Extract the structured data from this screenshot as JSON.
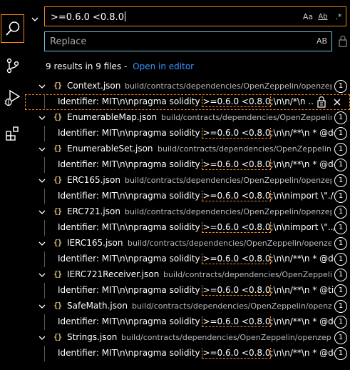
{
  "activity_bar": {
    "items": [
      {
        "icon": "search-icon",
        "active": true
      },
      {
        "icon": "source-control-icon",
        "active": false
      },
      {
        "icon": "run-debug-icon",
        "active": false
      },
      {
        "icon": "extensions-icon",
        "active": false
      }
    ]
  },
  "search": {
    "value": ">=0.6.0 <0.8.0",
    "options": {
      "match_case": "Aa",
      "whole_word": "Ab",
      "regex": ".*"
    }
  },
  "replace": {
    "placeholder": "Replace",
    "preserve_case": "AB"
  },
  "summary": {
    "count_text": "9 results in 9 files -",
    "open_editor": "Open in editor"
  },
  "results": [
    {
      "file": "Context.json",
      "path": "build/contracts/dependencies/OpenZeppelin/openzeppelin",
      "count": "1",
      "match": {
        "pre": "Identifier: MIT\\n\\npragma solidity ",
        "hl": ">=0.6.0 <0.8.0",
        "post": ";\\n\\n/*\\n ..."
      },
      "selected": true
    },
    {
      "file": "EnumerableMap.json",
      "path": "build/contracts/dependencies/OpenZeppelin/openzeppelin",
      "count": "1",
      "match": {
        "pre": "Identifier: MIT\\n\\npragma solidity ",
        "hl": ">=0.6.0 <0.8.0",
        "post": ";\\n\\n/**\\n * @dev Li..."
      },
      "selected": false
    },
    {
      "file": "EnumerableSet.json",
      "path": "build/contracts/dependencies/OpenZeppelin/openzeppelin",
      "count": "1",
      "match": {
        "pre": "Identifier: MIT\\n\\npragma solidity ",
        "hl": ">=0.6.0 <0.8.0",
        "post": ";\\n\\n/**\\n * @dev Li..."
      },
      "selected": false
    },
    {
      "file": "ERC165.json",
      "path": "build/contracts/dependencies/OpenZeppelin/openzeppelin",
      "count": "1",
      "match": {
        "pre": "Identifier: MIT\\n\\npragma solidity ",
        "hl": ">=0.6.0 <0.8.0",
        "post": ";\\n\\nimport \\\"./IERC..."
      },
      "selected": false
    },
    {
      "file": "ERC721.json",
      "path": "build/contracts/dependencies/OpenZeppelin/openzeppelin",
      "count": "1",
      "match": {
        "pre": "Identifier: MIT\\n\\npragma solidity ",
        "hl": ">=0.6.0 <0.8.0",
        "post": ";\\n\\nimport \\\"../../uti..."
      },
      "selected": false
    },
    {
      "file": "IERC165.json",
      "path": "build/contracts/dependencies/OpenZeppelin/openzeppelin",
      "count": "1",
      "match": {
        "pre": "Identifier: MIT\\n\\npragma solidity ",
        "hl": ">=0.6.0 <0.8.0",
        "post": ";\\n\\n/**\\n * @dev In..."
      },
      "selected": false
    },
    {
      "file": "IERC721Receiver.json",
      "path": "build/contracts/dependencies/OpenZeppelin/openzeppelin",
      "count": "1",
      "match": {
        "pre": "Identifier: MIT\\n\\npragma solidity ",
        "hl": ">=0.6.0 <0.8.0",
        "post": ";\\n\\n/**\\n * @title E..."
      },
      "selected": false
    },
    {
      "file": "SafeMath.json",
      "path": "build/contracts/dependencies/OpenZeppelin/openzeppelin",
      "count": "1",
      "match": {
        "pre": "Identifier: MIT\\n\\npragma solidity ",
        "hl": ">=0.6.0 <0.8.0",
        "post": ";\\n\\n/**\\n * @dev W..."
      },
      "selected": false
    },
    {
      "file": "Strings.json",
      "path": "build/contracts/dependencies/OpenZeppelin/openzeppelin",
      "count": "1",
      "match": {
        "pre": "Identifier: MIT\\n\\npragma solidity ",
        "hl": ">=0.6.0 <0.8.0",
        "post": ";\\n\\n/**\\n * @dev St..."
      },
      "selected": false
    }
  ],
  "colors": {
    "focus_border": "#f38518",
    "input_border": "#6fc3df",
    "link": "#3794ff",
    "json_icon": "#d7ba7d"
  }
}
